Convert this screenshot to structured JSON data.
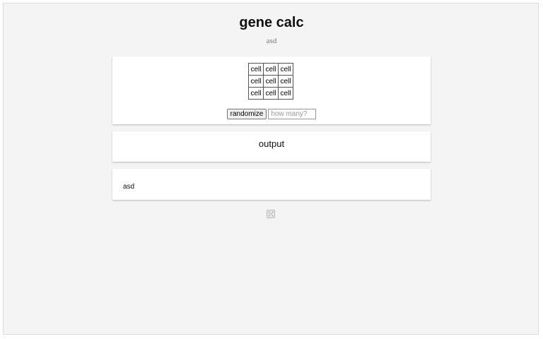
{
  "header": {
    "title": "gene calc",
    "subtitle": "asd"
  },
  "grid": {
    "rows": [
      [
        "cell",
        "cell",
        "cell"
      ],
      [
        "cell",
        "cell",
        "cell"
      ],
      [
        "cell",
        "cell",
        "cell"
      ]
    ]
  },
  "controls": {
    "randomize_label": "randomize",
    "count_placeholder": "how many?",
    "count_value": ""
  },
  "output": {
    "heading": "output"
  },
  "note": {
    "text": "asd"
  },
  "footer": {
    "icon": "dice-icon"
  }
}
